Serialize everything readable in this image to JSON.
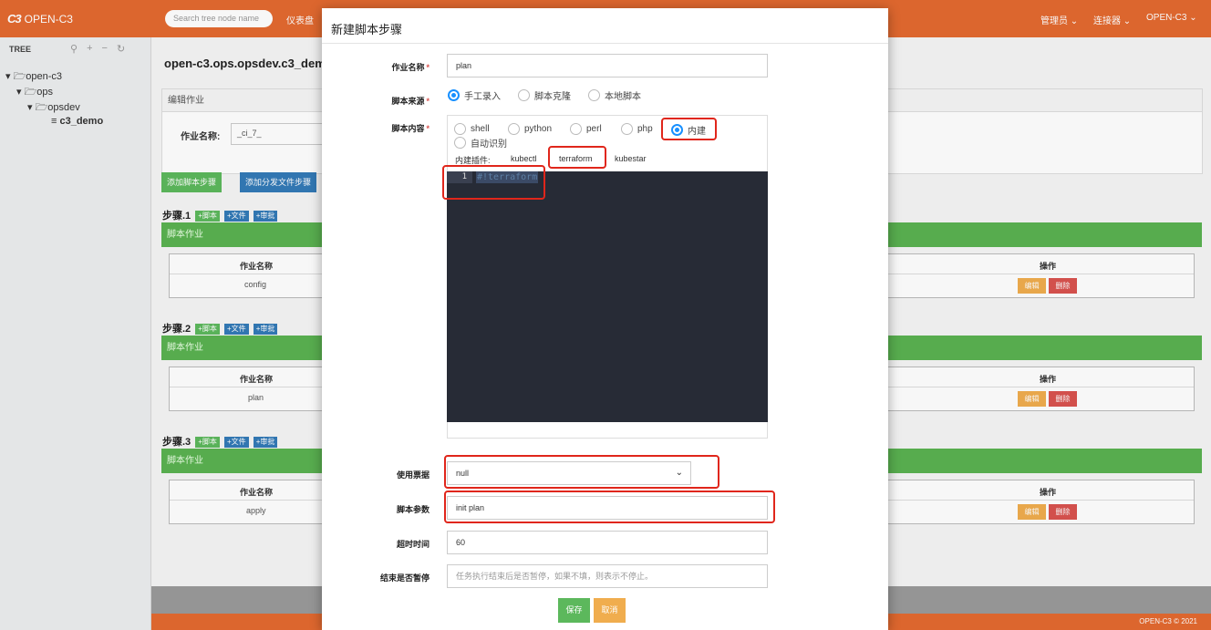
{
  "topbar": {
    "logo_mark": "C3",
    "logo_text": "OPEN-C3",
    "search_placeholder": "Search tree node name",
    "nav_dashboard": "仪表盘",
    "nav_admin": "管理员",
    "nav_connector": "连接器",
    "nav_openc3": "OPEN-C3",
    "caret": "⌄"
  },
  "sidebar": {
    "tree_label": "TREE",
    "tools": [
      "⚲",
      "+",
      "−",
      "↻"
    ],
    "nodes": [
      {
        "label": "▾ 🗁open-c3"
      },
      {
        "label": "▾ 🗁ops"
      },
      {
        "label": "▾ 🗁opsdev"
      },
      {
        "label": "≡ c3_demo"
      }
    ]
  },
  "main": {
    "page_title": "open-c3.ops.opsdev.c3_demo",
    "edit_header": "编辑作业",
    "job_name_label": "作业名称:",
    "job_name_value": "_ci_7_",
    "add_script_step": "添加脚本步骤",
    "add_dist_step": "添加分发文件步骤",
    "mini_script": "+脚本",
    "mini_file": "+文件",
    "mini_approve": "+审批",
    "col_job_name": "作业名称",
    "col_action": "操作",
    "edit_btn": "编辑",
    "delete_btn": "删除",
    "footer": "OPEN-C3 © 2021",
    "steps": [
      {
        "title": "步骤.1",
        "bar": "脚本作业",
        "job": "config"
      },
      {
        "title": "步骤.2",
        "bar": "脚本作业",
        "job": "plan"
      },
      {
        "title": "步骤.3",
        "bar": "脚本作业",
        "job": "apply"
      }
    ]
  },
  "modal": {
    "title": "新建脚本步骤",
    "job_name_label": "作业名称",
    "job_name_value": "plan",
    "source_label": "脚本来源",
    "source_options": [
      "手工录入",
      "脚本克隆",
      "本地脚本"
    ],
    "source_selected": "手工录入",
    "content_label": "脚本内容",
    "lang_options": [
      "shell",
      "python",
      "perl",
      "php",
      "内建",
      "自动识别"
    ],
    "lang_selected": "内建",
    "plugins_label": "内建插件:",
    "plugins": [
      "kubectl",
      "terraform",
      "kubestar"
    ],
    "editor_line_no": "1",
    "editor_code": "#!terraform",
    "ticket_label": "使用票据",
    "ticket_value": "null",
    "params_label": "脚本参数",
    "params_value": "init plan",
    "timeout_label": "超时时间",
    "timeout_value": "60",
    "pause_label": "结束是否暂停",
    "pause_placeholder": "任务执行结束后是否暂停，如果不填，则表示不停止。",
    "save_btn": "保存",
    "cancel_btn": "取消",
    "required_mark": "*"
  },
  "colors": {
    "brand": "#e46a30",
    "green": "#5cb85c",
    "blue": "#337ab7",
    "warn": "#f0ad4e",
    "danger": "#d9534f",
    "highlight": "#e0261b"
  }
}
